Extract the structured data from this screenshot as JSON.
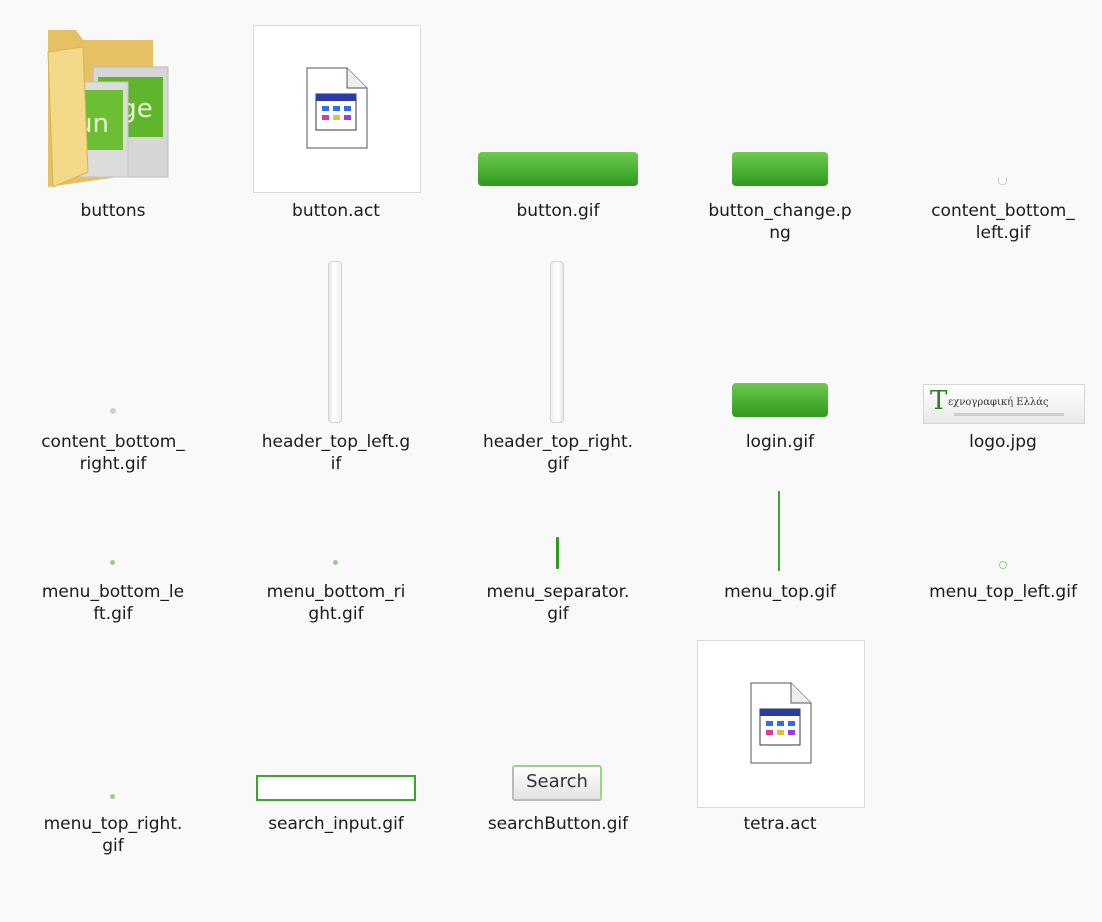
{
  "files": [
    {
      "name": "buttons",
      "icon": "folder-icon"
    },
    {
      "name": "button.act",
      "icon": "generic-document-icon"
    },
    {
      "name": "button.gif",
      "icon": "green-button-thumbnail"
    },
    {
      "name": "button_change.png",
      "icon": "green-button-thumbnail"
    },
    {
      "name": "content_bottom_left.gif",
      "icon": "corner-dot-thumbnail"
    },
    {
      "name": "content_bottom_right.gif",
      "icon": "corner-dot-thumbnail"
    },
    {
      "name": "header_top_left.gif",
      "icon": "vertical-bar-thumbnail"
    },
    {
      "name": "header_top_right.gif",
      "icon": "vertical-bar-thumbnail"
    },
    {
      "name": "login.gif",
      "icon": "green-button-thumbnail"
    },
    {
      "name": "logo.jpg",
      "icon": "logo-thumbnail"
    },
    {
      "name": "menu_bottom_left.gif",
      "icon": "corner-dot-thumbnail"
    },
    {
      "name": "menu_bottom_right.gif",
      "icon": "corner-dot-thumbnail"
    },
    {
      "name": "menu_separator.gif",
      "icon": "green-line-thumbnail"
    },
    {
      "name": "menu_top.gif",
      "icon": "green-line-thumbnail"
    },
    {
      "name": "menu_top_left.gif",
      "icon": "corner-dot-thumbnail"
    },
    {
      "name": "menu_top_right.gif",
      "icon": "corner-dot-thumbnail"
    },
    {
      "name": "search_input.gif",
      "icon": "search-input-thumbnail"
    },
    {
      "name": "searchButton.gif",
      "icon": "search-button-thumbnail"
    },
    {
      "name": "tetra.act",
      "icon": "generic-document-icon"
    }
  ],
  "label_lines": {
    "l0": [
      "buttons"
    ],
    "l1": [
      "button.act"
    ],
    "l2": [
      "button.gif"
    ],
    "l3": [
      "button_change.p",
      "ng"
    ],
    "l4": [
      "content_bottom_",
      "left.gif"
    ],
    "l5": [
      "content_bottom_",
      "right.gif"
    ],
    "l6": [
      "header_top_left.g",
      "if"
    ],
    "l7": [
      "header_top_right.",
      "gif"
    ],
    "l8": [
      "login.gif"
    ],
    "l9": [
      "logo.jpg"
    ],
    "l10": [
      "menu_bottom_le",
      "ft.gif"
    ],
    "l11": [
      "menu_bottom_ri",
      "ght.gif"
    ],
    "l12": [
      "menu_separator.",
      "gif"
    ],
    "l13": [
      "menu_top.gif"
    ],
    "l14": [
      "menu_top_left.gif"
    ],
    "l15": [
      "menu_top_right.",
      "gif"
    ],
    "l16": [
      "search_input.gif"
    ],
    "l17": [
      "searchButton.gif"
    ],
    "l18": [
      "tetra.act"
    ]
  },
  "logo_image_text": "Τεχνογραφική Ελλάς",
  "search_button_text": "Search",
  "colors": {
    "green": "#3aa62a",
    "green_dark": "#1f7f17",
    "folder": "#f3d27a"
  }
}
